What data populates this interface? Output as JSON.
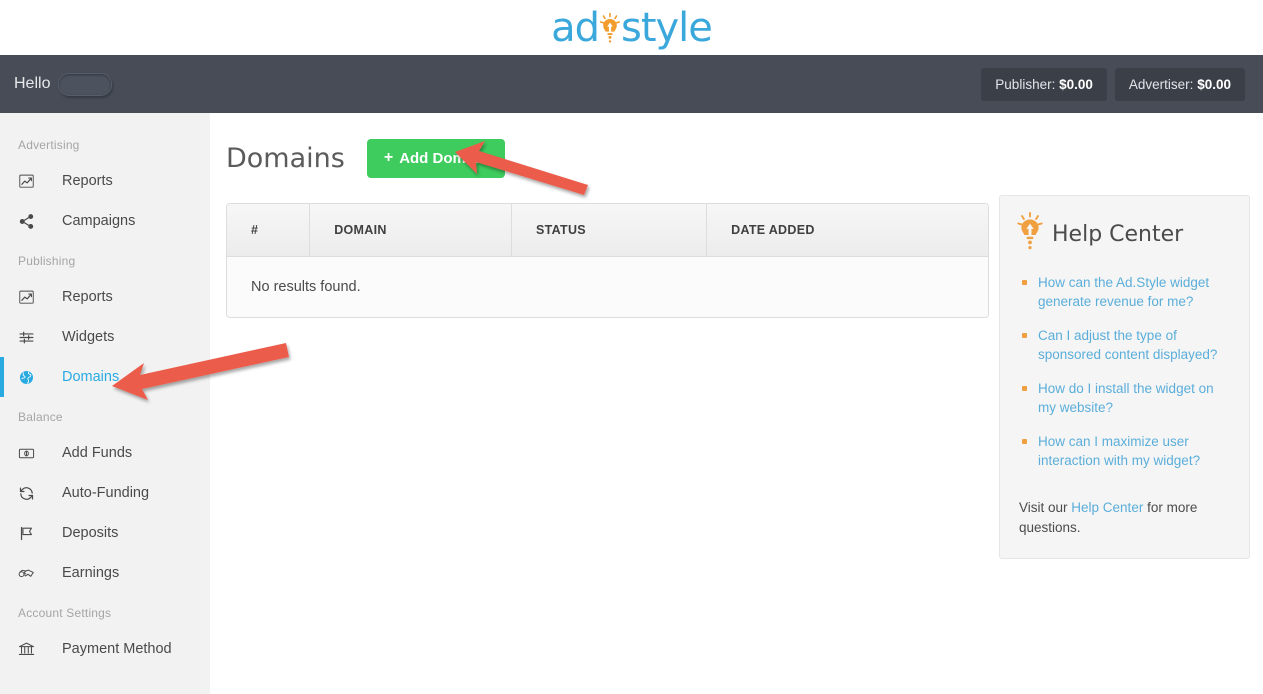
{
  "brand": {
    "logo_text_left": "ad",
    "logo_text_right": "style",
    "logo_icon": "lightbulb-icon",
    "logo_color": "#3BA8DC",
    "bulb_color": "#F29C2E"
  },
  "topbar": {
    "greeting": "Hello",
    "username_redacted": "",
    "publisher_balance_label": "Publisher:",
    "publisher_balance_value": "$0.00",
    "advertiser_balance_label": "Advertiser:",
    "advertiser_balance_value": "$0.00",
    "background": "#474C57"
  },
  "sidebar": {
    "background": "#F2F2F2",
    "active_color": "#29ABE2",
    "groups": [
      {
        "label": "Advertising",
        "items": [
          {
            "label": "Reports",
            "icon": "chart-line-icon",
            "active": false
          },
          {
            "label": "Campaigns",
            "icon": "share-alt-icon",
            "active": false
          }
        ]
      },
      {
        "label": "Publishing",
        "items": [
          {
            "label": "Reports",
            "icon": "chart-line-icon",
            "active": false
          },
          {
            "label": "Widgets",
            "icon": "sliders-icon",
            "active": false
          },
          {
            "label": "Domains",
            "icon": "globe-icon",
            "active": true
          }
        ]
      },
      {
        "label": "Balance",
        "items": [
          {
            "label": "Add Funds",
            "icon": "money-bill-icon",
            "active": false
          },
          {
            "label": "Auto-Funding",
            "icon": "sync-icon",
            "active": false
          },
          {
            "label": "Deposits",
            "icon": "flag-icon",
            "active": false
          },
          {
            "label": "Earnings",
            "icon": "handshake-icon",
            "active": false
          }
        ]
      },
      {
        "label": "Account Settings",
        "items": [
          {
            "label": "Payment Method",
            "icon": "bank-icon",
            "active": false
          }
        ]
      }
    ]
  },
  "main": {
    "page_title": "Domains",
    "add_button_label": "Add Domain",
    "add_button_plus": "+",
    "add_button_color": "#3ECC5F",
    "table": {
      "columns": [
        "#",
        "DOMAIN",
        "STATUS",
        "DATE ADDED"
      ],
      "rows": [],
      "empty_message": "No results found."
    }
  },
  "help_center": {
    "title": "Help Center",
    "icon": "lightbulb-icon",
    "icon_color": "#F0A040",
    "links": [
      "How can the Ad.Style widget generate revenue for me?",
      "Can I adjust the type of sponsored content displayed?",
      "How do I install the widget on my website?",
      "How can I maximize user interaction with my widget?"
    ],
    "footer_prefix": "Visit our ",
    "footer_link": "Help Center",
    "footer_suffix": " for more questions."
  },
  "annotations": {
    "arrow_color": "#EC5B4B",
    "arrows": [
      {
        "name": "arrow-to-add-domain-button",
        "points_at": "Add Domain"
      },
      {
        "name": "arrow-to-domains-sidebar-item",
        "points_at": "Domains"
      }
    ]
  }
}
